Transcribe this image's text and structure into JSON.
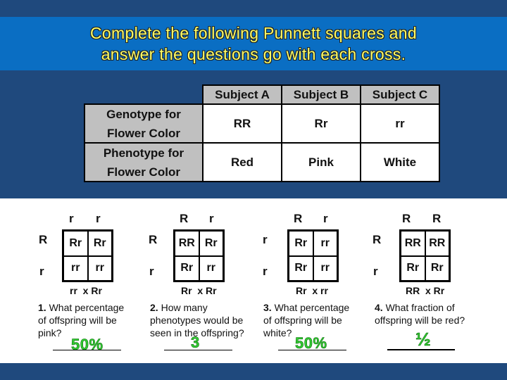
{
  "title": {
    "line1": "Complete the following Punnett squares and",
    "line2": "answer the questions go with each cross."
  },
  "colors": {
    "background": "#1f497d",
    "title_band": "#0a6ec3",
    "title_text": "#ffff66",
    "header_cells": "#c0c0c0",
    "answer_text": "#33cc33"
  },
  "table": {
    "columns": [
      "Subject A",
      "Subject B",
      "Subject C"
    ],
    "rows": [
      {
        "label_line1": "Genotype for",
        "label_line2": "Flower Color",
        "values": [
          "RR",
          "Rr",
          "rr"
        ]
      },
      {
        "label_line1": "Phenotype for",
        "label_line2": "Flower Color",
        "values": [
          "Red",
          "Pink",
          "White"
        ]
      }
    ]
  },
  "crosses": [
    {
      "top_alleles": [
        "r",
        "r"
      ],
      "side_alleles": [
        "R",
        "r"
      ],
      "cells": [
        "Rr",
        "Rr",
        "rr",
        "rr"
      ],
      "cross_label": "rr  x Rr",
      "question_number": "1.",
      "question_text": " What percentage of offspring will be pink?",
      "answer": "50%"
    },
    {
      "top_alleles": [
        "R",
        "r"
      ],
      "side_alleles": [
        "R",
        "r"
      ],
      "cells": [
        "RR",
        "Rr",
        "Rr",
        "rr"
      ],
      "cross_label": "Rr  x Rr",
      "question_number": "2.",
      "question_text": " How many phenotypes would be seen in the offspring?",
      "answer": "3"
    },
    {
      "top_alleles": [
        "R",
        "r"
      ],
      "side_alleles": [
        "r",
        "r"
      ],
      "cells": [
        "Rr",
        "rr",
        "Rr",
        "rr"
      ],
      "cross_label": "Rr  x rr",
      "question_number": "3.",
      "question_text": " What percentage of offspring will be white?",
      "answer": "50%"
    },
    {
      "top_alleles": [
        "R",
        "R"
      ],
      "side_alleles": [
        "R",
        "r"
      ],
      "cells": [
        "RR",
        "RR",
        "Rr",
        "Rr"
      ],
      "cross_label": "RR  x Rr",
      "question_number": "4.",
      "question_text": " What fraction of offspring will be red?",
      "answer": "½"
    }
  ]
}
